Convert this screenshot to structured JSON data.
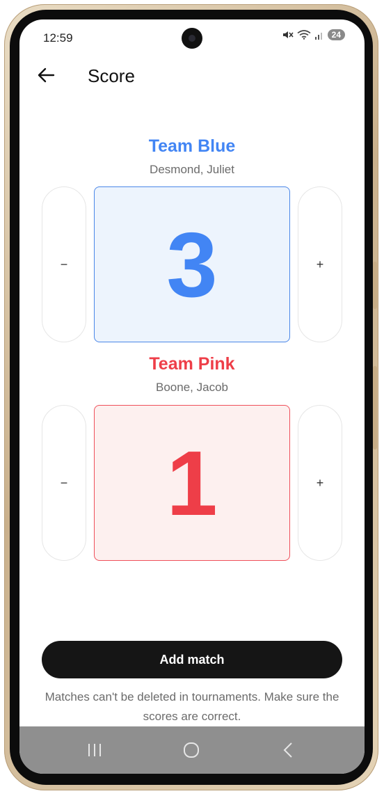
{
  "status_bar": {
    "time": "12:59",
    "battery": "24",
    "icons": [
      "mute-icon",
      "wifi-icon",
      "signal-icon"
    ]
  },
  "app_bar": {
    "title": "Score",
    "back_icon": "arrow-left-icon"
  },
  "teams": [
    {
      "name": "Team Blue",
      "players": "Desmond, Juliet",
      "score": "3",
      "color": "#4285f4",
      "decrement_label": "−",
      "increment_label": "+"
    },
    {
      "name": "Team Pink",
      "players": "Boone, Jacob",
      "score": "1",
      "color": "#ee3e48",
      "decrement_label": "−",
      "increment_label": "+"
    }
  ],
  "actions": {
    "add_match_label": "Add match"
  },
  "note": "Matches can't be deleted in tournaments. Make sure the scores are correct.",
  "nav_bar": {
    "items": [
      "recent-apps-icon",
      "home-icon",
      "back-icon"
    ]
  }
}
